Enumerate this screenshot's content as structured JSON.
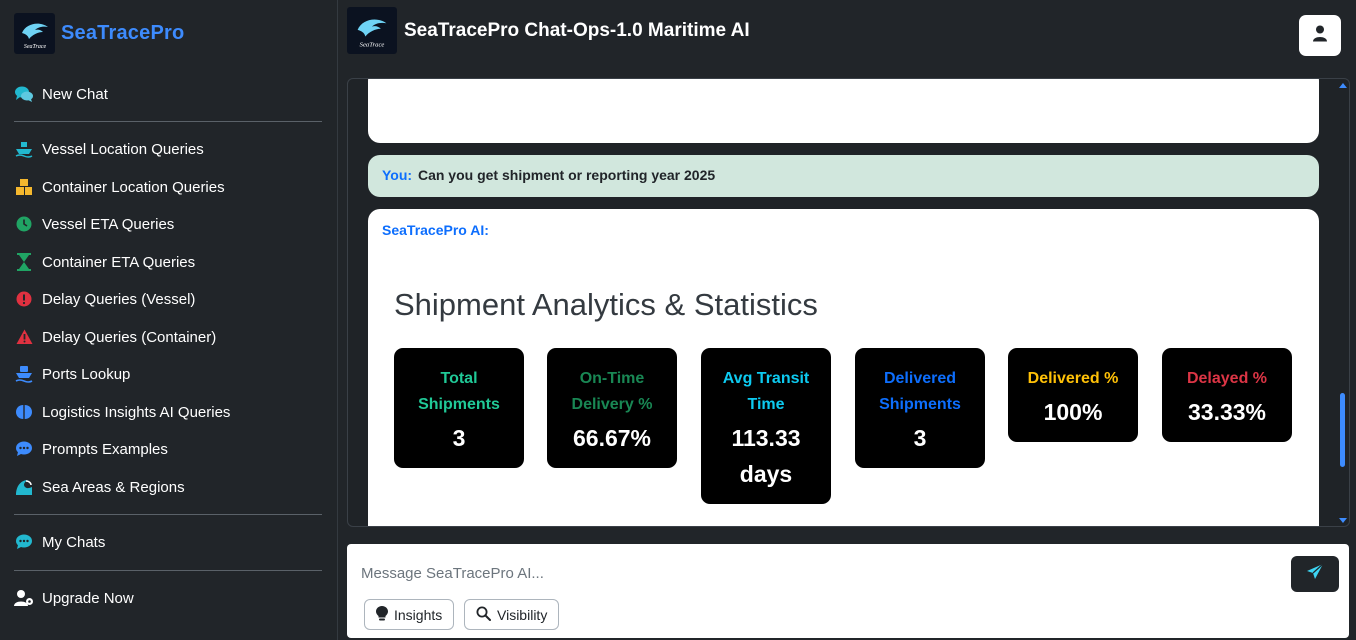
{
  "brand": {
    "name": "SeaTracePro",
    "logo_text": "SeaTrace"
  },
  "sidebar": {
    "new_chat": "New Chat",
    "items": [
      {
        "label": "Vessel Location Queries",
        "icon": "ship-icon",
        "color": "#22b8cf"
      },
      {
        "label": "Container Location Queries",
        "icon": "boxes-icon",
        "color": "#f5b82e"
      },
      {
        "label": "Vessel ETA Queries",
        "icon": "clock-icon",
        "color": "#20a464"
      },
      {
        "label": "Container ETA Queries",
        "icon": "hourglass-icon",
        "color": "#20a464"
      },
      {
        "label": "Delay Queries (Vessel)",
        "icon": "exclamation-circle-icon",
        "color": "#e03140"
      },
      {
        "label": "Delay Queries (Container)",
        "icon": "warning-triangle-icon",
        "color": "#e03140"
      },
      {
        "label": "Ports Lookup",
        "icon": "ferry-icon",
        "color": "#3d8bfd"
      },
      {
        "label": "Logistics Insights AI Queries",
        "icon": "brain-icon",
        "color": "#3d8bfd"
      },
      {
        "label": "Prompts Examples",
        "icon": "chat-dots-icon",
        "color": "#3d8bfd"
      },
      {
        "label": "Sea Areas & Regions",
        "icon": "wave-icon",
        "color": "#22b8cf"
      }
    ],
    "my_chats": "My Chats",
    "upgrade": "Upgrade Now"
  },
  "topbar": {
    "title": "SeaTracePro Chat-Ops-1.0 Maritime AI"
  },
  "chat": {
    "user_label": "You:",
    "user_message": "Can you get shipment or reporting year 2025",
    "ai_label": "SeaTracePro AI:",
    "ai_heading": "Shipment Analytics & Statistics",
    "stats": [
      {
        "label": "Total Shipments",
        "value": "3",
        "color": "#20c997"
      },
      {
        "label": "On-Time Delivery %",
        "value": "66.67%",
        "color": "#198754"
      },
      {
        "label": "Avg Transit Time",
        "value": "113.33 days",
        "color": "#0dcaf0"
      },
      {
        "label": "Delivered Shipments",
        "value": "3",
        "color": "#0d6efd"
      },
      {
        "label": "Delivered %",
        "value": "100%",
        "color": "#ffc107"
      },
      {
        "label": "Delayed %",
        "value": "33.33%",
        "color": "#dc3545"
      }
    ]
  },
  "composer": {
    "placeholder": "Message SeaTracePro AI...",
    "chips": [
      {
        "label": "Insights",
        "icon": "lightbulb-icon"
      },
      {
        "label": "Visibility",
        "icon": "search-icon"
      }
    ]
  }
}
